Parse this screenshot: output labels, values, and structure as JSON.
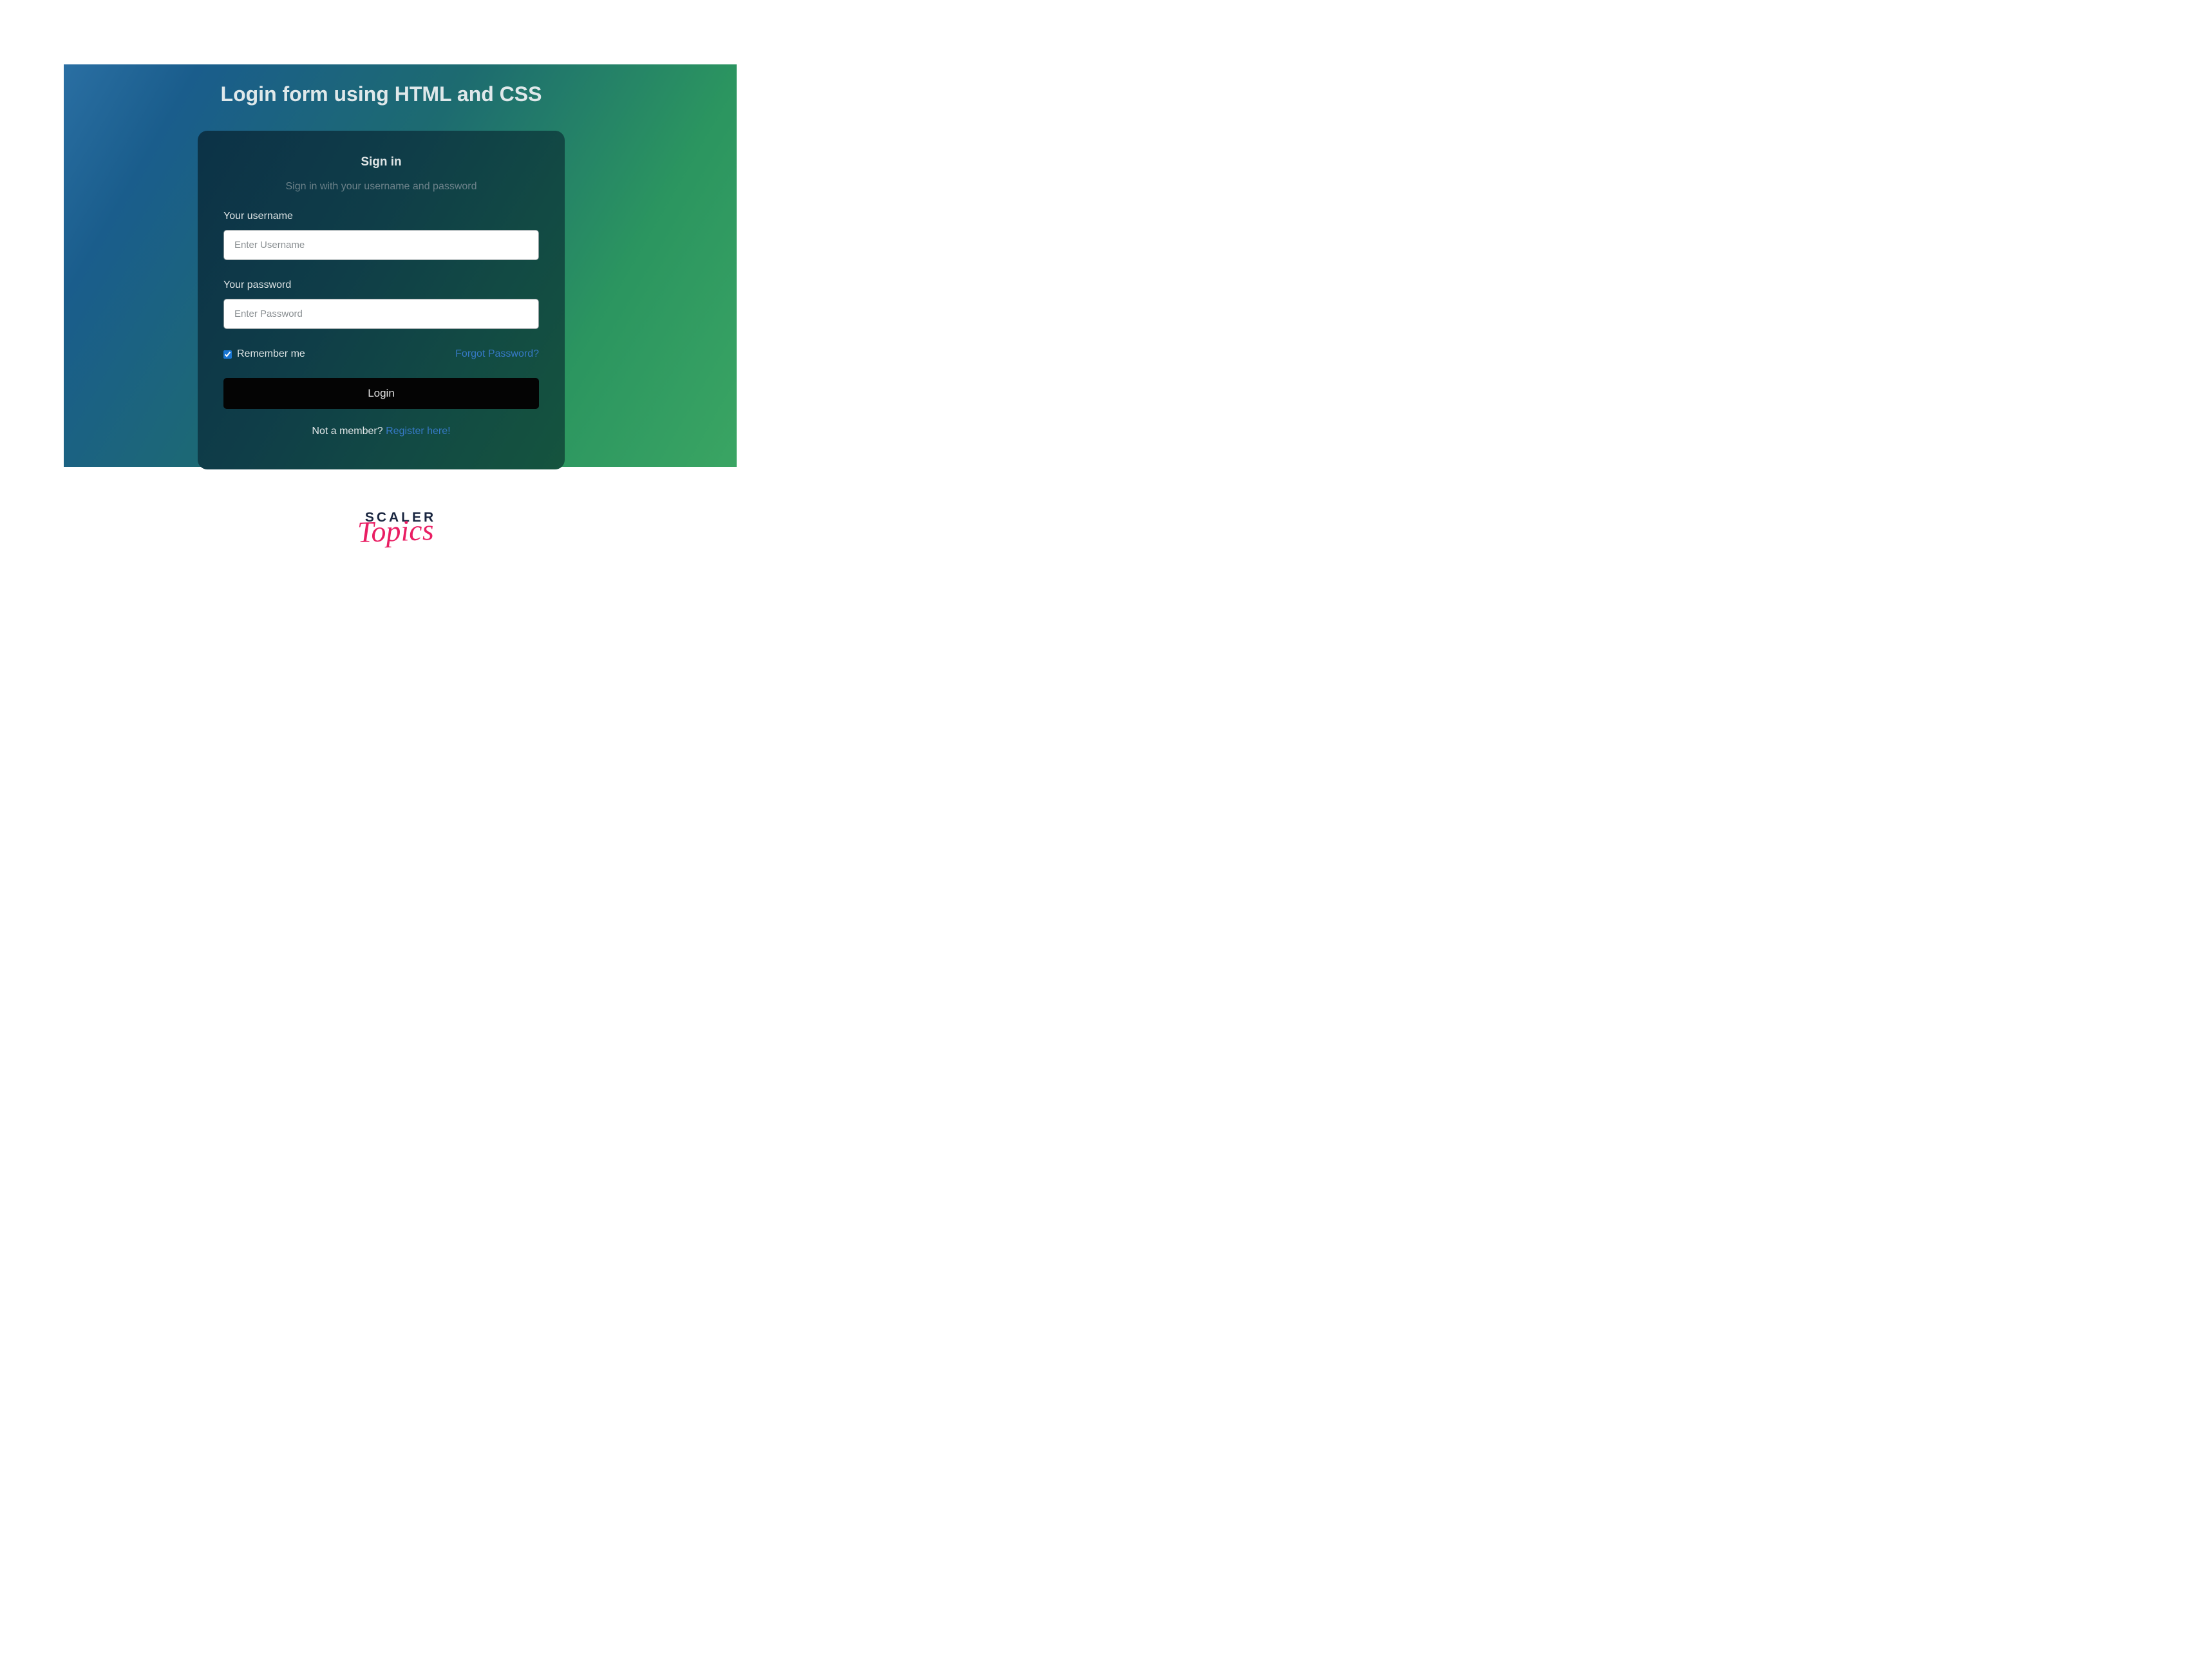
{
  "page": {
    "title": "Login form using HTML and CSS"
  },
  "card": {
    "title": "Sign in",
    "subtitle": "Sign in with your username and password"
  },
  "form": {
    "username_label": "Your username",
    "username_placeholder": "Enter Username",
    "password_label": "Your password",
    "password_placeholder": "Enter Password",
    "remember_label": "Remember me",
    "remember_checked": true,
    "forgot_link": "Forgot Password?",
    "login_button": "Login",
    "not_member_text": "Not a member? ",
    "register_link": "Register here!"
  },
  "footer": {
    "brand_line1": "SCALER",
    "brand_line2": "Topics"
  }
}
